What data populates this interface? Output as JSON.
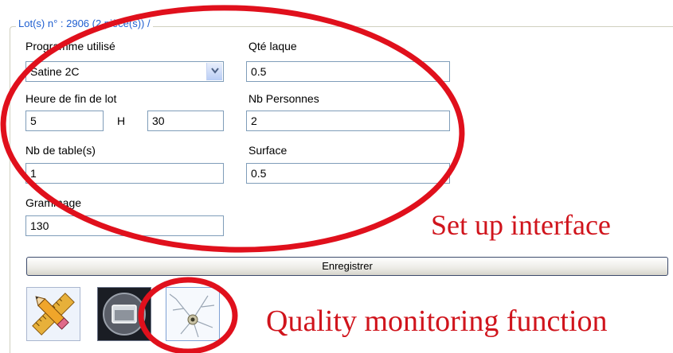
{
  "group": {
    "legend": "Lot(s) n° : 2906 (2 pièce(s)) /"
  },
  "form": {
    "programme_label": "Programme utilisé",
    "programme_value": "Satine 2C",
    "qte_label": "Qté laque",
    "qte_value": "0.5",
    "heure_label": "Heure de fin de lot",
    "heure_hours": "5",
    "heure_sep": "H",
    "heure_minutes": "30",
    "nbpers_label": "Nb Personnes",
    "nbpers_value": "2",
    "nbtable_label": "Nb de table(s)",
    "nbtable_value": "1",
    "surface_label": "Surface",
    "surface_value": "0.5",
    "grammage_label": "Grammage",
    "grammage_value": "130"
  },
  "actions": {
    "save_label": "Enregistrer"
  },
  "toolbar": {
    "icons": [
      "pencil-ruler-icon",
      "window-icon",
      "neuron-icon"
    ]
  },
  "annotations": {
    "setup": "Set up interface",
    "quality": "Quality monitoring function",
    "color": "#d0141c"
  }
}
